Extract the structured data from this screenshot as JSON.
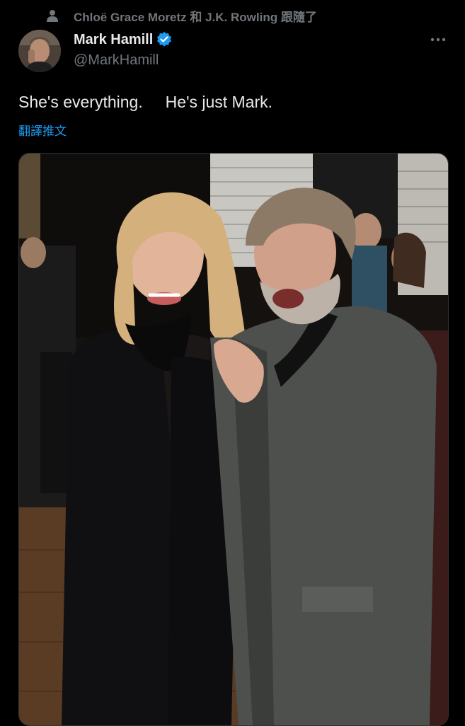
{
  "social_context": {
    "icon": "person-icon",
    "text": "Chloë Grace Moretz 和 J.K. Rowling 跟隨了"
  },
  "author": {
    "display_name": "Mark Hamill",
    "handle": "@MarkHamill",
    "verified_icon": "verified-badge-icon",
    "verified_color": "#1d9bf0"
  },
  "more_icon": "more-dots-icon",
  "tweet": {
    "text": "She's everything.     He's just Mark.",
    "translate_label": "翻譯推文"
  },
  "colors": {
    "background": "#000000",
    "primary_text": "#e7e9ea",
    "secondary_text": "#71767b",
    "link": "#1d9bf0"
  }
}
